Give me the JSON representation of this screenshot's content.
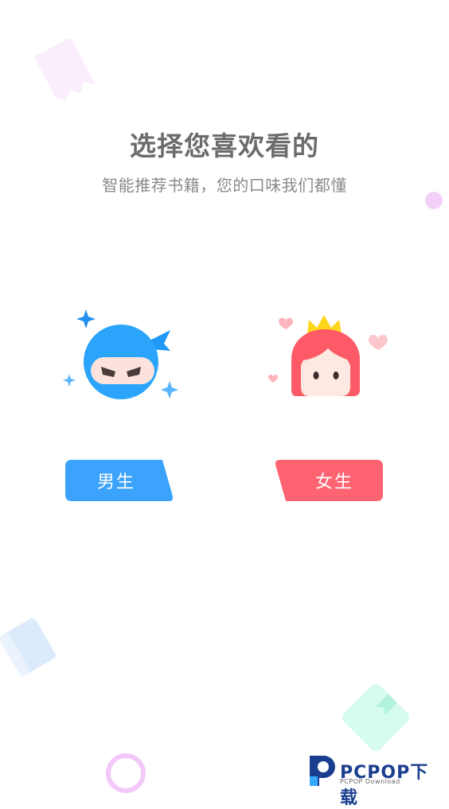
{
  "header": {
    "title": "选择您喜欢看的",
    "subtitle": "智能推荐书籍，您的口味我们都懂"
  },
  "options": {
    "male": {
      "label": "男生",
      "color": "#3ba3fb",
      "icon": "ninja-avatar-icon"
    },
    "female": {
      "label": "女生",
      "color": "#fe6371",
      "icon": "princess-avatar-icon"
    }
  },
  "watermark": {
    "brand": "PCPOP下载",
    "sub": "PCPOP Download"
  },
  "colors": {
    "title": "#6b6b6b",
    "subtitle": "#8a8a8a",
    "decor_pink": "#f3d0f7",
    "decor_blue": "#dcebfc",
    "decor_green": "#d6fbf0"
  }
}
